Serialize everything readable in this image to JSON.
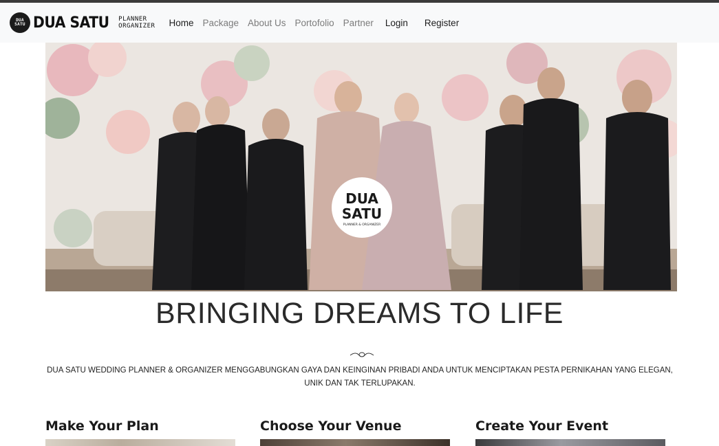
{
  "brand": {
    "badge_top": "DUA",
    "badge_bottom": "SATU",
    "wordmark": "DUA SATU",
    "sub_top": "PLANNER",
    "sub_bottom": "ORGANIZER"
  },
  "nav": {
    "items": [
      {
        "label": "Home"
      },
      {
        "label": "Package"
      },
      {
        "label": "About Us"
      },
      {
        "label": "Portofolio"
      },
      {
        "label": "Partner"
      }
    ],
    "login_label": "Login",
    "register_label": "Register"
  },
  "hero": {
    "logo_line1": "DUA",
    "logo_line2": "SATU",
    "logo_line3": "PLANNER & ORGANIZER"
  },
  "headline": "BRINGING DREAMS TO LIFE",
  "tagline": "DUA SATU WEDDING PLANNER & ORGANIZER MENGGABUNGKAN GAYA DAN KEINGINAN PRIBADI ANDA UNTUK MENCIPTAKAN PESTA PERNIKAHAN YANG ELEGAN, UNIK DAN TAK TERLUPAKAN.",
  "features": [
    {
      "title": "Make Your Plan"
    },
    {
      "title": "Choose Your Venue"
    },
    {
      "title": "Create Your Event"
    }
  ],
  "colors": {
    "navbar_bg": "#f8f9fa",
    "nav_active": "#1d1d1d",
    "nav_muted": "#7b7b7b"
  }
}
